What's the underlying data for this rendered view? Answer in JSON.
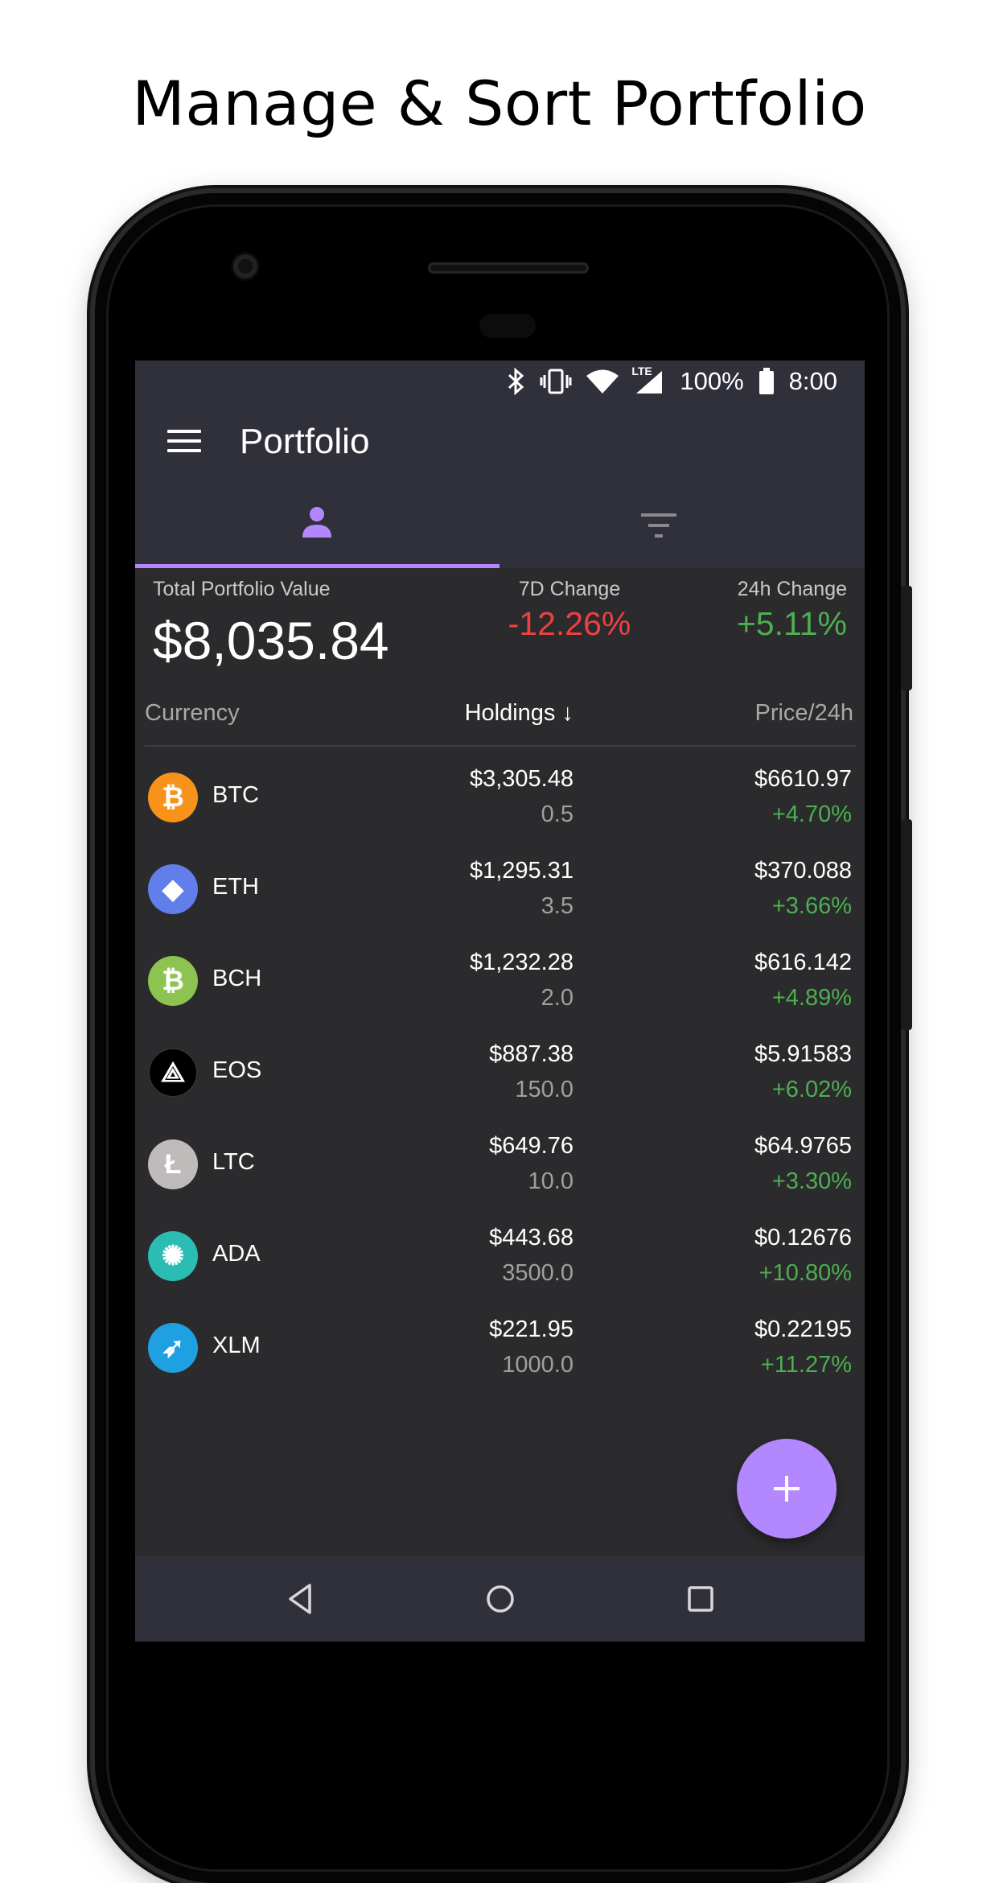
{
  "headline": "Manage & Sort Portfolio",
  "status_bar": {
    "network": "LTE",
    "battery": "100%",
    "time": "8:00"
  },
  "app_bar": {
    "title": "Portfolio"
  },
  "tabs": [
    {
      "icon": "person-icon",
      "active": true
    },
    {
      "icon": "filter-icon",
      "active": false
    }
  ],
  "summary": {
    "total_label": "Total Portfolio Value",
    "total_value": "$8,035.84",
    "change_7d_label": "7D Change",
    "change_7d_value": "-12.26%",
    "change_24h_label": "24h Change",
    "change_24h_value": "+5.11%"
  },
  "columns": {
    "currency": "Currency",
    "holdings": "Holdings ↓",
    "price": "Price/24h"
  },
  "coins": [
    {
      "symbol": "BTC",
      "holding": "$3,305.48",
      "quantity": "0.5",
      "price": "$6610.97",
      "change": "+4.70%",
      "icon": "bitcoin-icon",
      "color": "#f7931a",
      "glyph": "₿"
    },
    {
      "symbol": "ETH",
      "holding": "$1,295.31",
      "quantity": "3.5",
      "price": "$370.088",
      "change": "+3.66%",
      "icon": "ethereum-icon",
      "color": "#627eea",
      "glyph": "◆"
    },
    {
      "symbol": "BCH",
      "holding": "$1,232.28",
      "quantity": "2.0",
      "price": "$616.142",
      "change": "+4.89%",
      "icon": "bitcoin-cash-icon",
      "color": "#8dc351",
      "glyph": "₿"
    },
    {
      "symbol": "EOS",
      "holding": "$887.38",
      "quantity": "150.0",
      "price": "$5.91583",
      "change": "+6.02%",
      "icon": "eos-icon",
      "color": "#000000",
      "glyph": "⟁"
    },
    {
      "symbol": "LTC",
      "holding": "$649.76",
      "quantity": "10.0",
      "price": "$64.9765",
      "change": "+3.30%",
      "icon": "litecoin-icon",
      "color": "#bfbbbb",
      "glyph": "Ł"
    },
    {
      "symbol": "ADA",
      "holding": "$443.68",
      "quantity": "3500.0",
      "price": "$0.12676",
      "change": "+10.80%",
      "icon": "cardano-icon",
      "color": "#2bbdb3",
      "glyph": "✺"
    },
    {
      "symbol": "XLM",
      "holding": "$221.95",
      "quantity": "1000.0",
      "price": "$0.22195",
      "change": "+11.27%",
      "icon": "stellar-icon",
      "color": "#1fa0e0",
      "glyph": "➶"
    }
  ],
  "colors": {
    "accent": "#b388ff",
    "negative": "#ef4040",
    "positive": "#4caf50"
  }
}
